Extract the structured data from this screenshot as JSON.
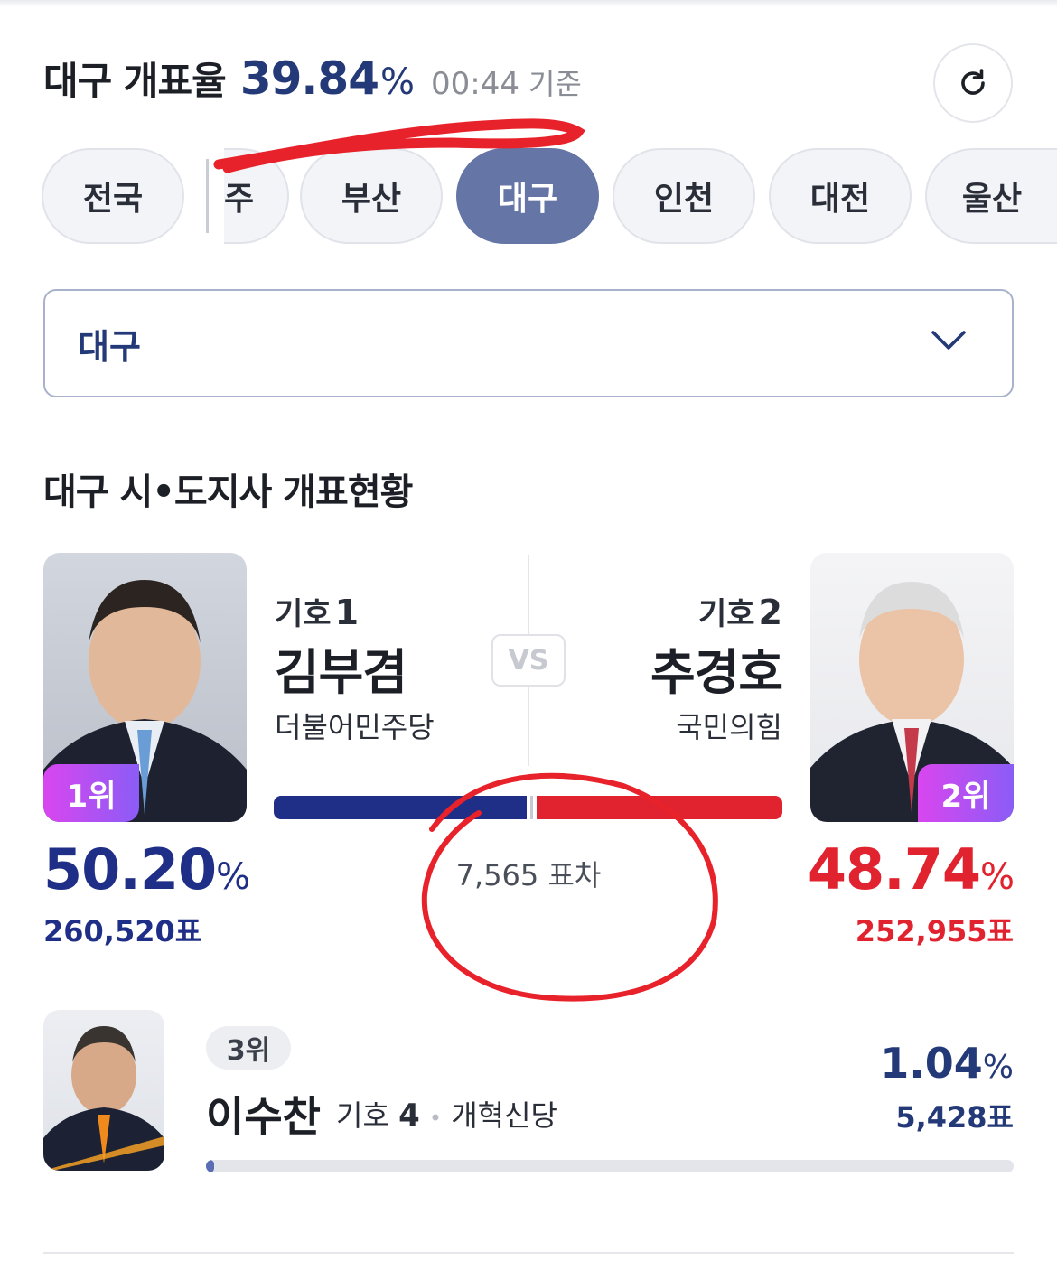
{
  "header": {
    "region_label": "대구 개표율",
    "count_rate": "39.84",
    "count_rate_unit": "%",
    "time": "00:44",
    "time_suffix": "기준"
  },
  "icons": {
    "refresh": "refresh-icon",
    "dropdown": "chevron-down-icon"
  },
  "region_tabs": [
    {
      "label": "전국",
      "active": false
    },
    {
      "label": "주",
      "active": false,
      "partially_visible": true
    },
    {
      "label": "부산",
      "active": false
    },
    {
      "label": "대구",
      "active": true
    },
    {
      "label": "인천",
      "active": false
    },
    {
      "label": "대전",
      "active": false
    },
    {
      "label": "울산",
      "active": false
    }
  ],
  "region_select": {
    "selected": "대구"
  },
  "section_title": "대구 시•도지사 개표현황",
  "candidates": {
    "first": {
      "rank": "1위",
      "number_label": "기호",
      "number": "1",
      "name": "김부겸",
      "party": "더불어민주당",
      "percent": "50.20",
      "percent_unit": "%",
      "votes": "260,520표",
      "color": "#1f2e86"
    },
    "vs": "VS",
    "second": {
      "rank": "2위",
      "number_label": "기호",
      "number": "2",
      "name": "추경호",
      "party": "국민의힘",
      "percent": "48.74",
      "percent_unit": "%",
      "votes": "252,955표",
      "color": "#e0232f"
    },
    "difference": "7,565 표차",
    "third": {
      "rank": "3위",
      "name": "이수찬",
      "number_label": "기호",
      "number": "4",
      "party": "개혁신당",
      "percent": "1.04",
      "percent_unit": "%",
      "votes": "5,428표",
      "bar_fraction": 0.0104
    }
  },
  "colors": {
    "accent": "#243a78",
    "active_tab": "#6475a6",
    "annotation": "#e8222a"
  }
}
